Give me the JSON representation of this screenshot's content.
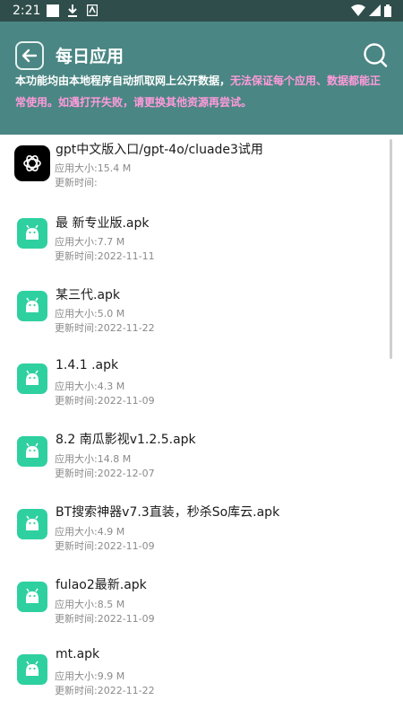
{
  "status_bar": {
    "time": "2:21"
  },
  "header": {
    "title": "每日应用",
    "notice_plain": "本功能均由本地程序自动抓取网上公开数据，",
    "notice_warn": "无法保证每个应用、数据都能正常使用。如遇打开失败，请更换其他资源再尝试。"
  },
  "apps": [
    {
      "name": "gpt中文版入口/gpt-4o/cluade3试用",
      "size": "应用大小:15.4 M",
      "updated": "更新时间:",
      "icon": "chatgpt-icon"
    },
    {
      "name": " 最 新专业版.apk",
      "size": "应用大小:7.7 M",
      "updated": "更新时间:2022-11-11",
      "icon": "android-icon"
    },
    {
      "name": " 某三代.apk",
      "size": "应用大小:5.0 M",
      "updated": "更新时间:2022-11-22",
      "icon": "android-icon"
    },
    {
      "name": "1.4.1 .apk",
      "size": "应用大小:4.3 M",
      "updated": "更新时间:2022-11-09",
      "icon": "android-icon"
    },
    {
      "name": "8.2  南瓜影视v1.2.5.apk",
      "size": "应用大小:14.8 M",
      "updated": "更新时间:2022-12-07",
      "icon": "android-icon"
    },
    {
      "name": "BT搜索神器v7.3直装，秒杀So库云.apk",
      "size": "应用大小:4.9 M",
      "updated": "更新时间:2022-11-09",
      "icon": "android-icon"
    },
    {
      "name": "fulao2最新.apk",
      "size": "应用大小:8.5 M",
      "updated": "更新时间:2022-11-09",
      "icon": "android-icon"
    },
    {
      "name": "mt.apk",
      "size": "应用大小:9.9 M",
      "updated": "更新时间:2022-11-22",
      "icon": "android-icon"
    }
  ],
  "colors": {
    "header": "#4a8683",
    "status_bar": "#2f4d4b",
    "notice_warn": "#ff9bdc",
    "app_icon": "#2fd0a0"
  }
}
